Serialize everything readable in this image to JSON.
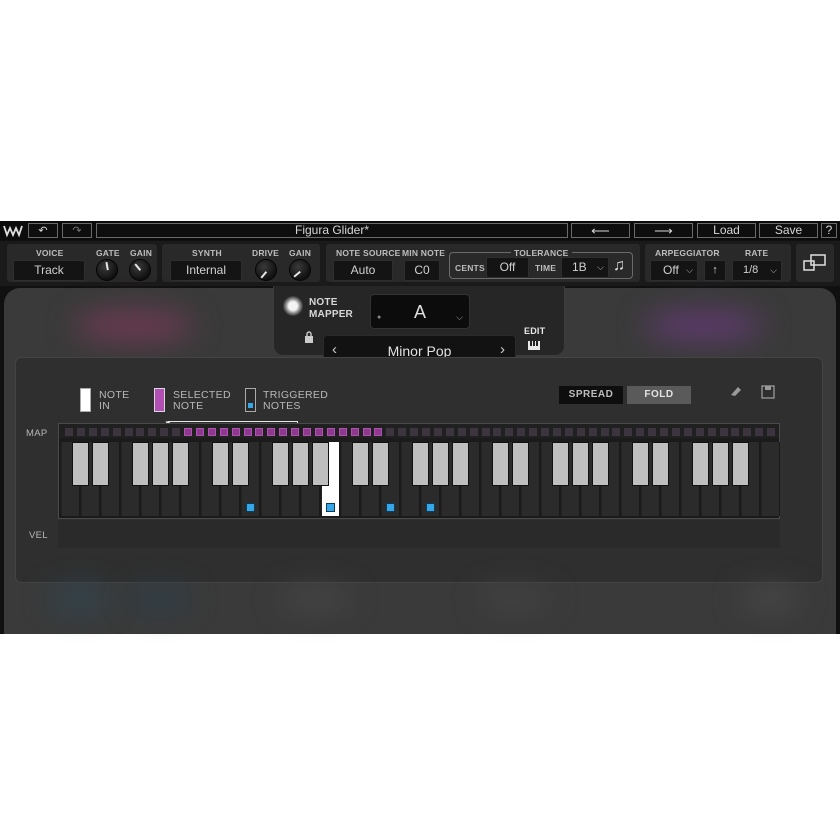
{
  "title_bar": {
    "title": "Figura Glider*",
    "undo_icon": "undo-icon",
    "redo_icon": "redo-icon",
    "prev_icon": "arrow-left-icon",
    "next_icon": "arrow-right-icon",
    "load_label": "Load",
    "save_label": "Save",
    "help_label": "?"
  },
  "voice": {
    "label": "VOICE",
    "value": "Track",
    "gate_label": "GATE",
    "gain_label": "GAIN"
  },
  "synth": {
    "label": "SYNTH",
    "value": "Internal",
    "drive_label": "DRIVE",
    "gain_label": "GAIN"
  },
  "note_source": {
    "label": "NOTE SOURCE",
    "value": "Auto"
  },
  "min_note": {
    "label": "MIN NOTE",
    "value": "C0"
  },
  "tolerance": {
    "label": "TOLERANCE",
    "cents_label": "CENTS",
    "cents_value": "Off",
    "time_label": "TIME",
    "time_value": "1B"
  },
  "arpeggiator": {
    "label": "ARPEGGIATOR",
    "value": "Off",
    "direction": "↑"
  },
  "rate": {
    "label": "RATE",
    "value": "1/8"
  },
  "note_mapper": {
    "label_line1": "NOTE",
    "label_line2": "MAPPER",
    "root_note": "A",
    "scale": "Minor Pop",
    "edit_label": "EDIT"
  },
  "legend": {
    "note_in_line1": "NOTE",
    "note_in_line2": "IN",
    "selected_line1": "SELECTED",
    "selected_line2": "NOTE",
    "triggered_line1": "TRIGGERED",
    "triggered_line2": "NOTES"
  },
  "mode": {
    "spread_label": "SPREAD",
    "fold_label": "FOLD",
    "active": "FOLD"
  },
  "rows": {
    "map_label": "MAP",
    "vel_label": "VEL"
  },
  "colors": {
    "selected_note": "#b24fb4",
    "triggered_note": "#35a7e8",
    "note_in": "#ffffff"
  }
}
